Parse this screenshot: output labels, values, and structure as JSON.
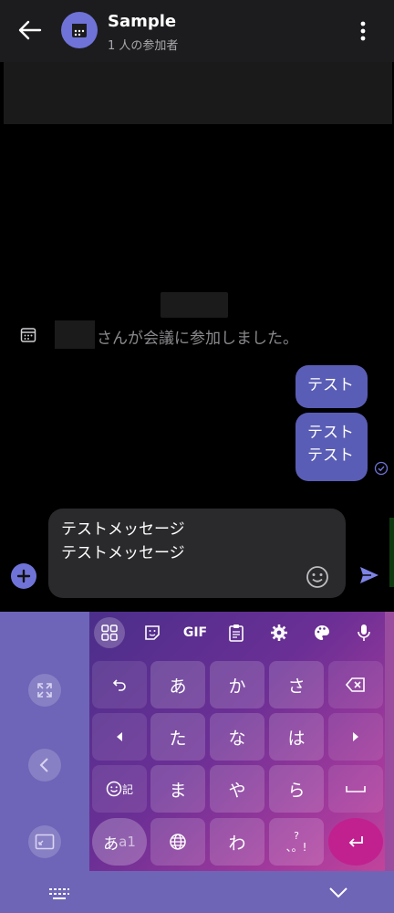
{
  "header": {
    "title": "Sample",
    "subtitle": "1 人の参加者"
  },
  "chat": {
    "system_message": "さんが会議に参加しました。",
    "bubbles": [
      {
        "lines": [
          "テスト"
        ]
      },
      {
        "lines": [
          "テスト",
          "テスト"
        ]
      }
    ]
  },
  "composer": {
    "lines": [
      "テストメッセージ",
      "テストメッセージ"
    ]
  },
  "keyboard": {
    "toolbar": {
      "gif_label": "GIF"
    },
    "rows": [
      [
        "あ",
        "か",
        "さ"
      ],
      [
        "た",
        "な",
        "は"
      ],
      [
        "ま",
        "や",
        "ら"
      ],
      [
        "わ"
      ]
    ],
    "emoji_key_label": "記",
    "kana_key_main": "あ",
    "kana_key_sub": "a1",
    "punct_key_label": "?",
    "punct_key_sub": "、。!"
  },
  "colors": {
    "accent": "#6f73d8",
    "bubble": "#5a5db5",
    "enter": "#c1218f"
  }
}
